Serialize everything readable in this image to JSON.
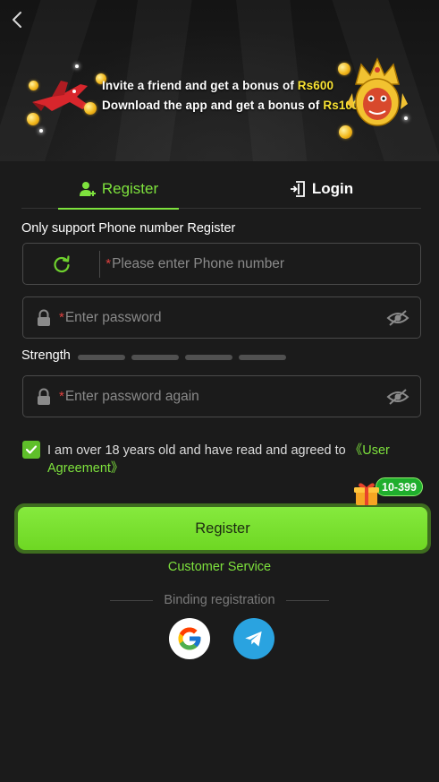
{
  "banner": {
    "line1_text": "Invite a friend and get a bonus of ",
    "line1_amount": "Rs600",
    "line2_text": "Download the app and get a bonus of ",
    "line2_amount": "Rs100"
  },
  "tabs": {
    "register_label": "Register",
    "login_label": "Login"
  },
  "form": {
    "support_text": "Only support Phone number Register",
    "phone_placeholder": "Please enter Phone number",
    "password_placeholder": "Enter password",
    "strength_label": "Strength",
    "confirm_placeholder": "Enter password again",
    "required_mark": "*"
  },
  "agreement": {
    "text": "I am over 18 years old and have read and agreed to ",
    "link": "《User Agreement》",
    "checked": true
  },
  "gift_badge": "10-399",
  "register_button": "Register",
  "customer_service": "Customer Service",
  "binding_label": "Binding registration",
  "colors": {
    "accent": "#7ee23d",
    "background": "#1b1b1b",
    "required": "#e0413f",
    "telegram": "#2aa3e0"
  },
  "icons": {
    "back": "chevron-left-icon",
    "register_tab": "user-plus-icon",
    "login_tab": "door-enter-icon",
    "country": "refresh-icon",
    "lock": "lock-icon",
    "eye": "eye-off-icon",
    "google": "google-icon",
    "telegram": "telegram-icon"
  }
}
